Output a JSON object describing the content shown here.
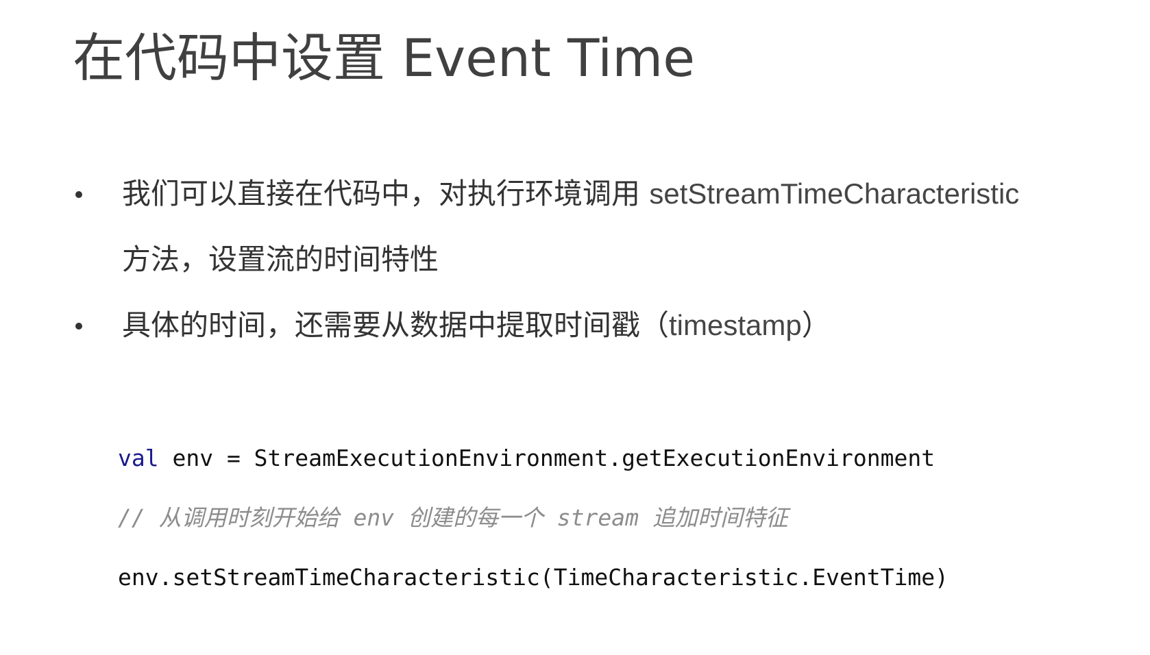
{
  "slide": {
    "title": "在代码中设置 Event Time"
  },
  "bullets": [
    {
      "text_cn": "我们可以直接在代码中，对执行环境调用 ",
      "text_latin": "setStreamTimeCharacteristic"
    },
    {
      "text_cn": "方法，设置流的时间特性"
    },
    {
      "text_cn": "具体的时间，还需要从数据中提取时间戳（",
      "text_latin": "timestamp",
      "text_end": "）"
    }
  ],
  "code": {
    "line1_keyword": "val",
    "line1_rest": " env = StreamExecutionEnvironment.getExecutionEnvironment",
    "line2_comment": "// 从调用时刻开始给 env 创建的每一个 stream 追加时间特征",
    "line3": "env.setStreamTimeCharacteristic(TimeCharacteristic.EventTime)"
  },
  "colors": {
    "title": "#404040",
    "text": "#333333",
    "keyword": "#1a1a8c",
    "comment": "#8c8c8c",
    "code": "#111111"
  }
}
